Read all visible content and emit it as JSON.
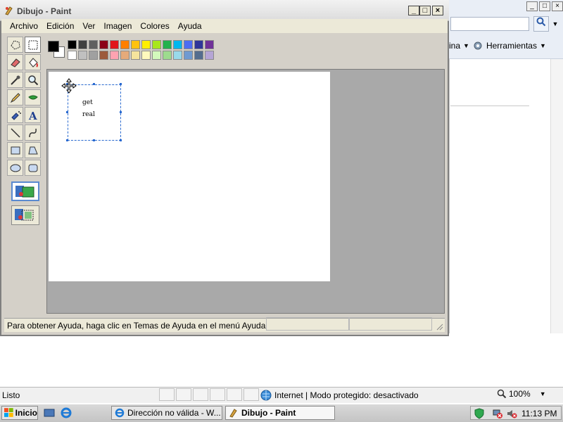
{
  "ie": {
    "tools_partial": "ina",
    "tools_label": "Herramientas",
    "status_text": "Listo",
    "zone_text": "Internet | Modo protegido: desactivado",
    "zoom_text": "100%",
    "caption_min": "_",
    "caption_max": "□",
    "caption_close": "×"
  },
  "paint": {
    "title": "Dibujo - Paint",
    "menu": [
      "Archivo",
      "Edición",
      "Ver",
      "Imagen",
      "Colores",
      "Ayuda"
    ],
    "selection_text": [
      "get",
      "real"
    ],
    "status_text": "Para obtener Ayuda, haga clic en Temas de Ayuda en el menú Ayuda",
    "foreground_color": "#000000",
    "background_color": "#ffffff",
    "palette_top": [
      "#000000",
      "#404040",
      "#606060",
      "#8b0016",
      "#e1141a",
      "#ff7f00",
      "#ffc20e",
      "#ffef00",
      "#a8e61d",
      "#22b14c",
      "#00b7ef",
      "#4d6df3",
      "#2f3699",
      "#6f3198"
    ],
    "palette_bottom": [
      "#ffffff",
      "#c0c0c0",
      "#a0a0a0",
      "#9c5a3c",
      "#ffa3b1",
      "#e5aa7a",
      "#f5e49c",
      "#fff9bd",
      "#d3f9bc",
      "#9ddb8e",
      "#99d9ea",
      "#709ad1",
      "#546d8e",
      "#b5a5d5"
    ]
  },
  "taskbar": {
    "start_label": "Inicio",
    "items": [
      "Dirección no válida - W...",
      "Dibujo - Paint"
    ],
    "clock": "11:13 PM"
  }
}
